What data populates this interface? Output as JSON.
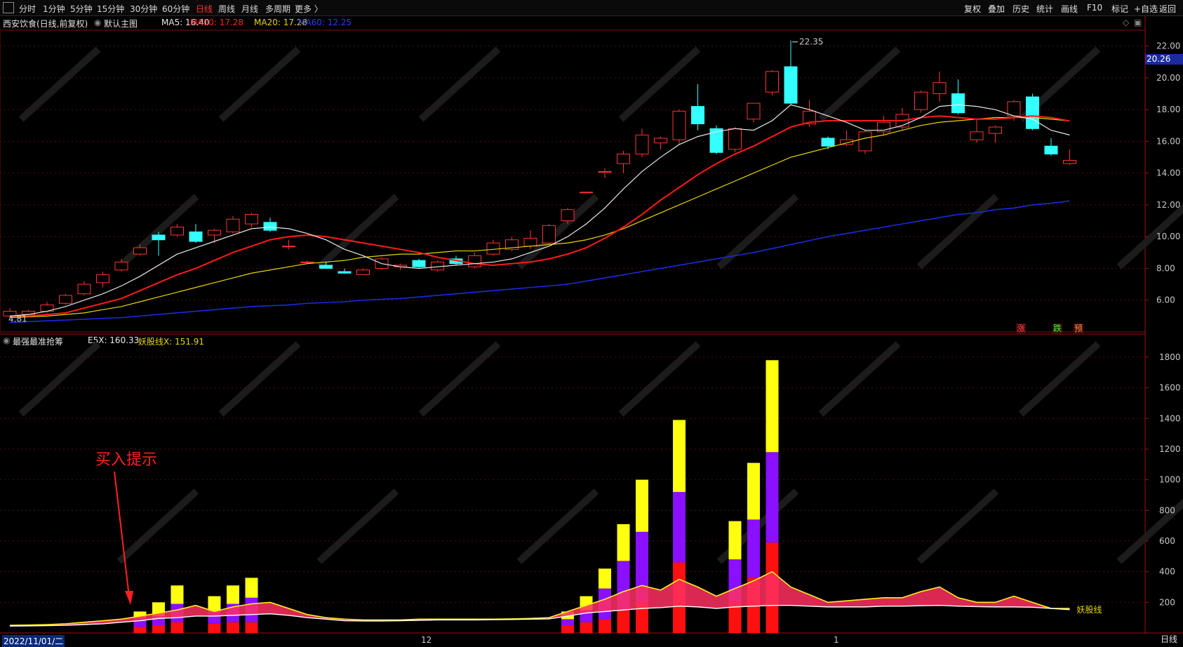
{
  "toolbar": {
    "periods": [
      "分时",
      "1分钟",
      "5分钟",
      "15分钟",
      "30分钟",
      "60分钟",
      "日线",
      "周线",
      "月线",
      "多周期",
      "更多 〉"
    ],
    "active_period": "日线",
    "tools": [
      "复权",
      "叠加",
      "历史",
      "统计",
      "画线",
      "F10",
      "标记",
      "+自选",
      "返回"
    ]
  },
  "stock": {
    "name": "西安饮食(日线,前复权)",
    "main_chart": "默认主图",
    "ma5": "MA5: 16.40",
    "ma10": "MA10: 17.28",
    "ma20": "MA20: 17.28",
    "ma60": "MA60: 12.25",
    "high_label": "22.35",
    "low_label": "4.81",
    "last_price_badge": "20.26",
    "colors": {
      "up": "#ff3333",
      "down": "#33ffff",
      "ma5": "#e8e8e8",
      "ma10": "#ff1a1a",
      "ma20": "#e6d600",
      "ma60": "#1a2ae0"
    }
  },
  "indicator": {
    "name": "最强最准抢筹",
    "e5x": "E5X: 160.33",
    "yaogu": "妖股线X: 151.91",
    "annotation": "买入提示",
    "line_label": "妖股线"
  },
  "markers": {
    "zhang": "涨",
    "die": "跌",
    "yu": "预"
  },
  "axis": {
    "price_ticks": [
      "22.00",
      "20.00",
      "18.00",
      "16.00",
      "14.00",
      "12.00",
      "10.00",
      "8.00",
      "6.00"
    ],
    "ind_ticks": [
      "1800",
      "1600",
      "1400",
      "1200",
      "1000",
      "800",
      "600",
      "400",
      "200"
    ],
    "dates": {
      "first": "2022/11/01/二",
      "dec": "12",
      "jan": "1"
    },
    "mode": "日线"
  },
  "chart_data": {
    "type": "candlestick",
    "price_ylim": [
      4,
      23
    ],
    "candles": [
      {
        "o": 5.0,
        "c": 5.3,
        "h": 5.5,
        "l": 4.81
      },
      {
        "o": 5.1,
        "c": 5.3,
        "h": 5.4,
        "l": 5.0
      },
      {
        "o": 5.3,
        "c": 5.7,
        "h": 5.9,
        "l": 5.2
      },
      {
        "o": 5.8,
        "c": 6.3,
        "h": 6.4,
        "l": 5.7
      },
      {
        "o": 6.4,
        "c": 7.0,
        "h": 7.2,
        "l": 6.3
      },
      {
        "o": 7.1,
        "c": 7.6,
        "h": 7.8,
        "l": 6.8
      },
      {
        "o": 7.9,
        "c": 8.4,
        "h": 8.6,
        "l": 7.8
      },
      {
        "o": 8.9,
        "c": 9.3,
        "h": 9.5,
        "l": 8.8
      },
      {
        "o": 10.1,
        "c": 9.8,
        "h": 10.3,
        "l": 8.8
      },
      {
        "o": 10.1,
        "c": 10.6,
        "h": 10.8,
        "l": 10.0
      },
      {
        "o": 10.3,
        "c": 9.7,
        "h": 10.8,
        "l": 9.6
      },
      {
        "o": 10.1,
        "c": 10.4,
        "h": 10.5,
        "l": 9.6
      },
      {
        "o": 10.3,
        "c": 11.1,
        "h": 11.3,
        "l": 10.2
      },
      {
        "o": 10.8,
        "c": 11.4,
        "h": 11.5,
        "l": 10.6
      },
      {
        "o": 10.9,
        "c": 10.4,
        "h": 11.2,
        "l": 10.3
      },
      {
        "o": 9.4,
        "c": 9.4,
        "h": 9.8,
        "l": 9.2
      },
      {
        "o": 8.4,
        "c": 8.4,
        "h": 8.5,
        "l": 8.4
      },
      {
        "o": 8.2,
        "c": 8.0,
        "h": 8.4,
        "l": 8.0
      },
      {
        "o": 7.8,
        "c": 7.7,
        "h": 8.0,
        "l": 7.7
      },
      {
        "o": 7.6,
        "c": 7.9,
        "h": 8.0,
        "l": 7.6
      },
      {
        "o": 8.0,
        "c": 8.6,
        "h": 8.7,
        "l": 7.9
      },
      {
        "o": 8.1,
        "c": 8.2,
        "h": 8.3,
        "l": 7.9
      },
      {
        "o": 8.5,
        "c": 8.1,
        "h": 8.6,
        "l": 8.0
      },
      {
        "o": 7.9,
        "c": 8.4,
        "h": 8.5,
        "l": 7.8
      },
      {
        "o": 8.6,
        "c": 8.3,
        "h": 8.8,
        "l": 8.2
      },
      {
        "o": 8.1,
        "c": 8.8,
        "h": 9.0,
        "l": 8.0
      },
      {
        "o": 8.9,
        "c": 9.6,
        "h": 9.8,
        "l": 8.8
      },
      {
        "o": 9.2,
        "c": 9.8,
        "h": 10.0,
        "l": 9.1
      },
      {
        "o": 9.4,
        "c": 9.9,
        "h": 10.4,
        "l": 9.2
      },
      {
        "o": 9.6,
        "c": 10.7,
        "h": 10.8,
        "l": 9.5
      },
      {
        "o": 11.0,
        "c": 11.7,
        "h": 11.8,
        "l": 10.8
      },
      {
        "o": 12.8,
        "c": 12.8,
        "h": 12.8,
        "l": 12.8
      },
      {
        "o": 14.1,
        "c": 14.1,
        "h": 14.3,
        "l": 13.7
      },
      {
        "o": 14.6,
        "c": 15.2,
        "h": 15.4,
        "l": 14.0
      },
      {
        "o": 15.2,
        "c": 16.4,
        "h": 16.8,
        "l": 15.0
      },
      {
        "o": 15.9,
        "c": 16.2,
        "h": 16.3,
        "l": 15.5
      },
      {
        "o": 16.1,
        "c": 17.9,
        "h": 18.0,
        "l": 15.8
      },
      {
        "o": 18.2,
        "c": 17.1,
        "h": 19.6,
        "l": 16.7
      },
      {
        "o": 16.8,
        "c": 15.3,
        "h": 17.0,
        "l": 15.2
      },
      {
        "o": 15.5,
        "c": 16.8,
        "h": 16.9,
        "l": 15.3
      },
      {
        "o": 17.4,
        "c": 18.4,
        "h": 18.4,
        "l": 17.2
      },
      {
        "o": 19.1,
        "c": 20.4,
        "h": 20.5,
        "l": 18.9
      },
      {
        "o": 20.7,
        "c": 18.4,
        "h": 22.35,
        "l": 18.3
      },
      {
        "o": 17.1,
        "c": 17.9,
        "h": 18.6,
        "l": 16.9
      },
      {
        "o": 16.2,
        "c": 15.7,
        "h": 16.3,
        "l": 15.5
      },
      {
        "o": 15.8,
        "c": 16.1,
        "h": 16.7,
        "l": 15.7
      },
      {
        "o": 15.4,
        "c": 16.6,
        "h": 16.7,
        "l": 15.2
      },
      {
        "o": 16.6,
        "c": 17.2,
        "h": 17.6,
        "l": 16.4
      },
      {
        "o": 16.9,
        "c": 17.7,
        "h": 18.1,
        "l": 16.7
      },
      {
        "o": 18.0,
        "c": 19.1,
        "h": 19.2,
        "l": 17.8
      },
      {
        "o": 19.0,
        "c": 19.7,
        "h": 20.4,
        "l": 18.5
      },
      {
        "o": 19.0,
        "c": 17.8,
        "h": 19.9,
        "l": 17.7
      },
      {
        "o": 16.1,
        "c": 16.6,
        "h": 17.4,
        "l": 15.9
      },
      {
        "o": 16.5,
        "c": 16.9,
        "h": 17.0,
        "l": 15.9
      },
      {
        "o": 17.6,
        "c": 18.5,
        "h": 18.6,
        "l": 17.3
      },
      {
        "o": 18.8,
        "c": 16.8,
        "h": 19.0,
        "l": 16.7
      },
      {
        "o": 15.7,
        "c": 15.2,
        "h": 16.2,
        "l": 15.1
      },
      {
        "o": 14.6,
        "c": 14.8,
        "h": 15.5,
        "l": 14.5
      }
    ],
    "ma5": [
      5.0,
      5.1,
      5.3,
      5.6,
      6.0,
      6.4,
      6.9,
      7.5,
      8.2,
      8.9,
      9.3,
      9.7,
      10.1,
      10.5,
      10.6,
      10.5,
      10.2,
      9.8,
      9.2,
      8.8,
      8.3,
      8.1,
      8.0,
      8.1,
      8.2,
      8.3,
      8.4,
      8.6,
      9.0,
      9.4,
      10.0,
      10.8,
      11.8,
      13.0,
      14.1,
      15.0,
      15.8,
      16.3,
      16.6,
      16.8,
      16.7,
      17.3,
      18.3,
      18.0,
      17.6,
      17.2,
      16.7,
      16.7,
      17.0,
      17.5,
      18.2,
      18.3,
      18.2,
      18.0,
      17.6,
      17.4,
      16.7,
      16.4
    ],
    "ma10": [
      5.0,
      5.0,
      5.1,
      5.2,
      5.5,
      5.8,
      6.1,
      6.6,
      7.1,
      7.6,
      8.0,
      8.5,
      9.0,
      9.4,
      9.8,
      10.0,
      10.1,
      10.0,
      9.8,
      9.6,
      9.4,
      9.2,
      9.0,
      8.7,
      8.5,
      8.3,
      8.2,
      8.3,
      8.4,
      8.6,
      8.9,
      9.3,
      9.9,
      10.6,
      11.4,
      12.3,
      13.1,
      13.9,
      14.6,
      15.2,
      15.7,
      16.3,
      16.9,
      17.2,
      17.3,
      17.3,
      17.3,
      17.3,
      17.3,
      17.5,
      17.6,
      17.5,
      17.4,
      17.4,
      17.5,
      17.6,
      17.5,
      17.28
    ],
    "ma20": [
      4.9,
      4.95,
      5.0,
      5.1,
      5.2,
      5.4,
      5.6,
      5.9,
      6.2,
      6.5,
      6.8,
      7.1,
      7.4,
      7.7,
      7.9,
      8.1,
      8.3,
      8.4,
      8.5,
      8.7,
      8.8,
      8.9,
      8.9,
      9.0,
      9.1,
      9.1,
      9.2,
      9.3,
      9.4,
      9.5,
      9.6,
      9.8,
      10.1,
      10.5,
      11.0,
      11.5,
      12.0,
      12.5,
      13.0,
      13.5,
      14.0,
      14.5,
      15.0,
      15.3,
      15.6,
      15.9,
      16.2,
      16.4,
      16.7,
      17.0,
      17.2,
      17.3,
      17.4,
      17.5,
      17.5,
      17.5,
      17.4,
      17.28
    ],
    "ma60": [
      4.6,
      4.65,
      4.7,
      4.75,
      4.8,
      4.85,
      4.9,
      5.0,
      5.1,
      5.2,
      5.3,
      5.4,
      5.5,
      5.6,
      5.65,
      5.7,
      5.8,
      5.85,
      5.9,
      6.0,
      6.05,
      6.1,
      6.2,
      6.3,
      6.4,
      6.5,
      6.6,
      6.7,
      6.8,
      6.9,
      7.0,
      7.2,
      7.4,
      7.6,
      7.8,
      8.0,
      8.2,
      8.4,
      8.6,
      8.8,
      9.0,
      9.25,
      9.5,
      9.75,
      10.0,
      10.2,
      10.4,
      10.6,
      10.8,
      11.0,
      11.2,
      11.4,
      11.5,
      11.7,
      11.8,
      12.0,
      12.1,
      12.25
    ],
    "ind_ylim": [
      0,
      1850
    ],
    "bars": [
      {
        "i": 7,
        "red": 40,
        "purple": 60,
        "yellow": 40
      },
      {
        "i": 8,
        "red": 50,
        "purple": 60,
        "yellow": 90
      },
      {
        "i": 9,
        "red": 70,
        "purple": 120,
        "yellow": 120
      },
      {
        "i": 11,
        "red": 60,
        "purple": 80,
        "yellow": 100
      },
      {
        "i": 12,
        "red": 70,
        "purple": 120,
        "yellow": 120
      },
      {
        "i": 13,
        "red": 70,
        "purple": 160,
        "yellow": 130
      },
      {
        "i": 30,
        "red": 50,
        "purple": 40,
        "yellow": 50
      },
      {
        "i": 31,
        "red": 70,
        "purple": 80,
        "yellow": 90
      },
      {
        "i": 32,
        "red": 90,
        "purple": 200,
        "yellow": 130
      },
      {
        "i": 33,
        "red": 150,
        "purple": 320,
        "yellow": 240
      },
      {
        "i": 34,
        "red": 200,
        "purple": 460,
        "yellow": 340
      },
      {
        "i": 36,
        "red": 460,
        "purple": 460,
        "yellow": 470
      },
      {
        "i": 39,
        "red": 200,
        "purple": 280,
        "yellow": 250
      },
      {
        "i": 40,
        "red": 360,
        "purple": 380,
        "yellow": 370
      },
      {
        "i": 41,
        "red": 590,
        "purple": 590,
        "yellow": 600
      }
    ],
    "e5x": [
      50,
      52,
      55,
      60,
      70,
      80,
      90,
      110,
      130,
      150,
      180,
      140,
      170,
      190,
      200,
      160,
      120,
      100,
      90,
      85,
      85,
      85,
      90,
      90,
      90,
      90,
      90,
      92,
      95,
      100,
      140,
      180,
      220,
      270,
      310,
      280,
      350,
      300,
      240,
      290,
      340,
      400,
      300,
      250,
      200,
      210,
      220,
      230,
      230,
      270,
      300,
      230,
      200,
      200,
      240,
      200,
      160,
      160
    ],
    "yaogu": [
      45,
      46,
      48,
      50,
      55,
      60,
      70,
      80,
      95,
      100,
      110,
      110,
      115,
      120,
      125,
      115,
      100,
      90,
      80,
      78,
      78,
      80,
      82,
      85,
      85,
      85,
      87,
      88,
      90,
      92,
      110,
      130,
      140,
      150,
      160,
      165,
      175,
      170,
      160,
      170,
      175,
      180,
      180,
      175,
      170,
      170,
      170,
      175,
      175,
      178,
      180,
      175,
      172,
      170,
      170,
      168,
      160,
      152
    ]
  }
}
